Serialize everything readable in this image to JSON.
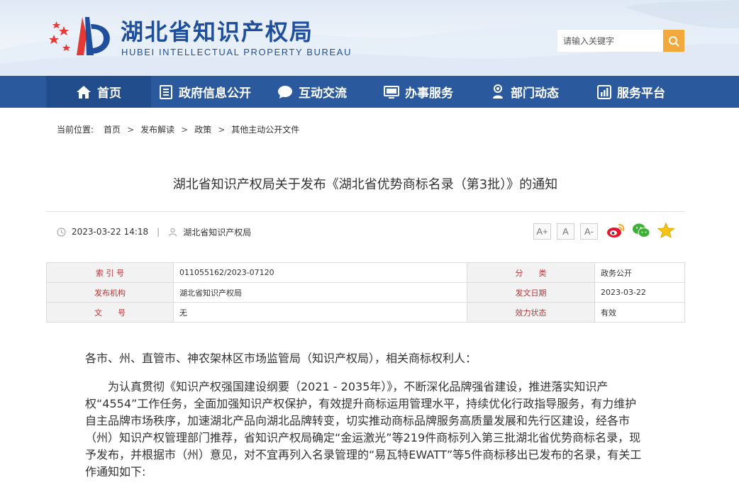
{
  "header": {
    "title": "湖北省知识产权局",
    "subtitle": "HUBEI INTELLECTUAL PROPERTY BUREAU",
    "search_placeholder": "请输入关键字"
  },
  "nav": {
    "items": [
      {
        "label": "首页",
        "icon": "home-icon"
      },
      {
        "label": "政府信息公开",
        "icon": "document-list-icon"
      },
      {
        "label": "互动交流",
        "icon": "chat-bubble-icon"
      },
      {
        "label": "办事服务",
        "icon": "monitor-icon"
      },
      {
        "label": "部门动态",
        "icon": "person-pin-icon"
      },
      {
        "label": "服务平台",
        "icon": "chart-icon"
      }
    ]
  },
  "breadcrumb": {
    "label": "当前位置:",
    "items": [
      "首页",
      "发布解读",
      "政策",
      "其他主动公开文件"
    ]
  },
  "article": {
    "title": "湖北省知识产权局关于发布《湖北省优势商标名录（第3批）》的通知",
    "datetime": "2023-03-22 14:18",
    "source": "湖北省知识产权局",
    "font_buttons": [
      "A+",
      "A",
      "A-"
    ],
    "share": [
      "weibo-icon",
      "wechat-icon",
      "favorite-star-icon"
    ]
  },
  "info_table": {
    "rows": [
      {
        "l1": "索 引 号",
        "v1": "011055162/2023-07120",
        "l2": "分　　类",
        "v2": "政务公开"
      },
      {
        "l1": "发布机构",
        "v1": "湖北省知识产权局",
        "l2": "发文日期",
        "v2": "2023-03-22"
      },
      {
        "l1": "文　　号",
        "v1": "无",
        "l2": "效力状态",
        "v2": "有效"
      }
    ]
  },
  "body": {
    "greeting": "各市、州、直管市、神农架林区市场监管局（知识产权局），相关商标权利人：",
    "paragraph": "为认真贯彻《知识产权强国建设纲要（2021 - 2035年）》，不断深化品牌强省建设，推进落实知识产权“4554”工作任务，全面加强知识产权保护，有效提升商标运用管理水平，持续优化行政指导服务，有力维护自主品牌市场秩序，加速湖北产品向湖北品牌转变，切实推动商标品牌服务高质量发展和先行区建设，经各市（州）知识产权管理部门推荐，省知识产权局确定“金运激光”等219件商标列入第三批湖北省优势商标名录，现予发布，并根据市（州）意见，对不宜再列入名录管理的“易瓦特EWATT”等5件商标移出已发布的名录，有关工作通知如下:"
  },
  "colors": {
    "brand_blue": "#1f4f9c",
    "nav_blue": "#2a5a9d",
    "search_orange": "#f2a93b",
    "label_red": "#b4363b"
  }
}
